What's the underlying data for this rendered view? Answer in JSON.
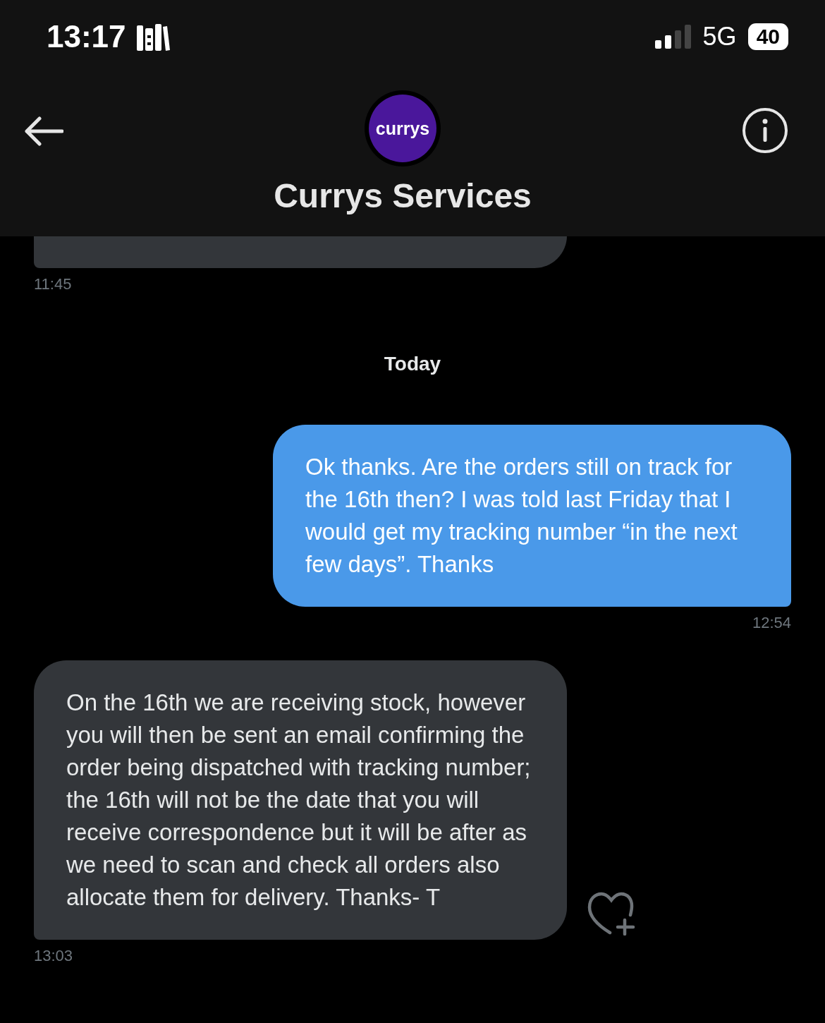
{
  "status_bar": {
    "time": "13:17",
    "network": "5G",
    "battery": "40"
  },
  "header": {
    "avatar_text": "currys",
    "title": "Currys Services"
  },
  "messages": [
    {
      "kind": "received",
      "time": "11:45"
    },
    {
      "kind": "date",
      "text": "Today"
    },
    {
      "kind": "sent",
      "text": "Ok thanks. Are the orders still on track for the 16th then? I was told last Friday that I would get my tracking number “in the next few days”. Thanks",
      "time": "12:54"
    },
    {
      "kind": "received",
      "text": "On the 16th we are receiving stock, however you will then be sent an email confirming the order being dispatched with tracking number; the 16th will not be the date that you will receive correspondence but it will be after as we need to scan and check all orders also allocate them for delivery. Thanks- T",
      "time": "13:03",
      "reaction_button": true
    }
  ]
}
